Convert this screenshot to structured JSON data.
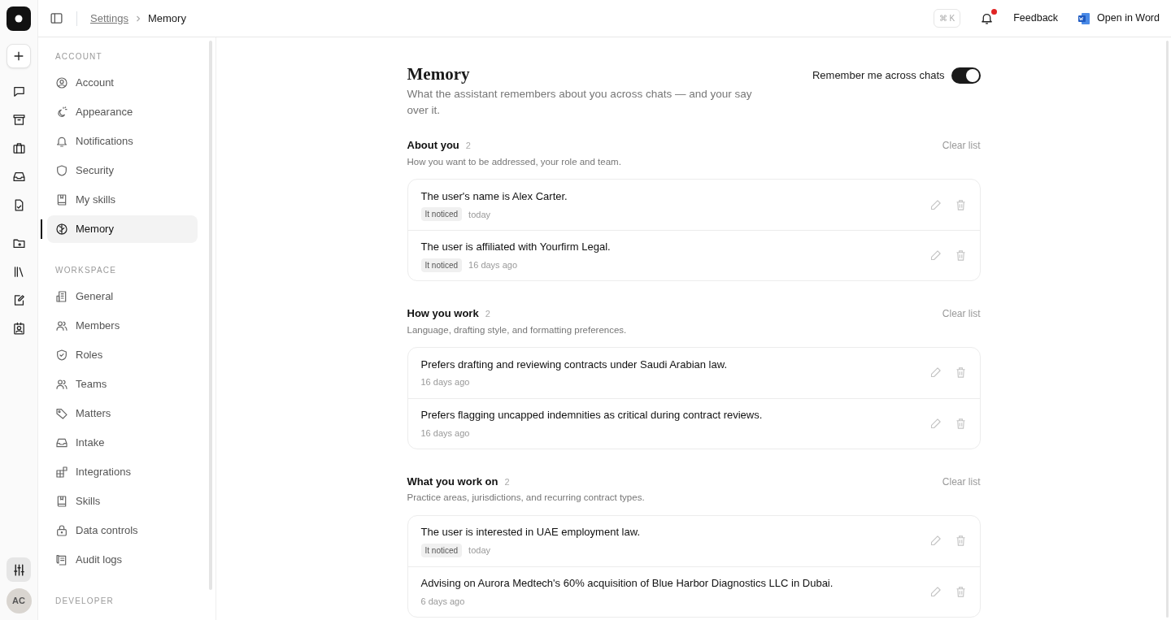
{
  "rail": {
    "items": [
      {
        "kind": "chat"
      },
      {
        "kind": "archive"
      },
      {
        "kind": "briefcase"
      },
      {
        "kind": "inbox"
      },
      {
        "kind": "filecheck"
      },
      {
        "kind": "folder"
      },
      {
        "kind": "library"
      },
      {
        "kind": "edit"
      },
      {
        "kind": "contact"
      }
    ],
    "settings": {
      "selected": true
    },
    "avatar": "AC"
  },
  "breadcrumb": [
    "Settings",
    "Memory"
  ],
  "header": {
    "shortcut": "⌘ K",
    "notification_dot": true,
    "feedback": "Feedback",
    "open_word": "Open in Word"
  },
  "nav": [
    {
      "title": "ACCOUNT",
      "items": [
        {
          "label": "Account",
          "selected": false
        },
        {
          "label": "Appearance",
          "selected": false
        },
        {
          "label": "Notifications",
          "selected": false
        },
        {
          "label": "Security",
          "selected": false
        },
        {
          "label": "My skills",
          "selected": false
        },
        {
          "label": "Memory",
          "selected": true
        }
      ]
    },
    {
      "title": "WORKSPACE",
      "items": [
        {
          "label": "General",
          "selected": false
        },
        {
          "label": "Members",
          "selected": false
        },
        {
          "label": "Roles",
          "selected": false
        },
        {
          "label": "Teams",
          "selected": false
        },
        {
          "label": "Matters",
          "selected": false
        },
        {
          "label": "Intake",
          "selected": false
        },
        {
          "label": "Integrations",
          "selected": false
        },
        {
          "label": "Skills",
          "selected": false
        },
        {
          "label": "Data controls",
          "selected": false
        },
        {
          "label": "Audit logs",
          "selected": false
        }
      ]
    },
    {
      "title": "DEVELOPER"
    }
  ],
  "page": {
    "title": "Memory",
    "subtitle": "What the assistant remembers about you across chats — and your say over it.",
    "toggle": {
      "label": "Remember me across chats",
      "on": true
    }
  },
  "groups": [
    {
      "title": "About you",
      "count": "2",
      "description": "How you want to be addressed, your role and team.",
      "clear": "Clear list",
      "items": [
        {
          "text": "The user's name is Alex Carter.",
          "tag": "It noticed",
          "time": "today"
        },
        {
          "text": "The user is affiliated with Yourfirm Legal.",
          "tag": "It noticed",
          "time": "16 days ago"
        }
      ]
    },
    {
      "title": "How you work",
      "count": "2",
      "description": "Language, drafting style, and formatting preferences.",
      "clear": "Clear list",
      "items": [
        {
          "text": "Prefers drafting and reviewing contracts under Saudi Arabian law.",
          "time": "16 days ago"
        },
        {
          "text": "Prefers flagging uncapped indemnities as critical during contract reviews.",
          "time": "16 days ago"
        }
      ]
    },
    {
      "title": "What you work on",
      "count": "2",
      "description": "Practice areas, jurisdictions, and recurring contract types.",
      "clear": "Clear list",
      "items": [
        {
          "text": "The user is interested in UAE employment law.",
          "tag": "It noticed",
          "time": "today"
        },
        {
          "text": "Advising on Aurora Medtech's 60% acquisition of Blue Harbor Diagnostics LLC in Dubai.",
          "time": "6 days ago"
        }
      ]
    }
  ]
}
